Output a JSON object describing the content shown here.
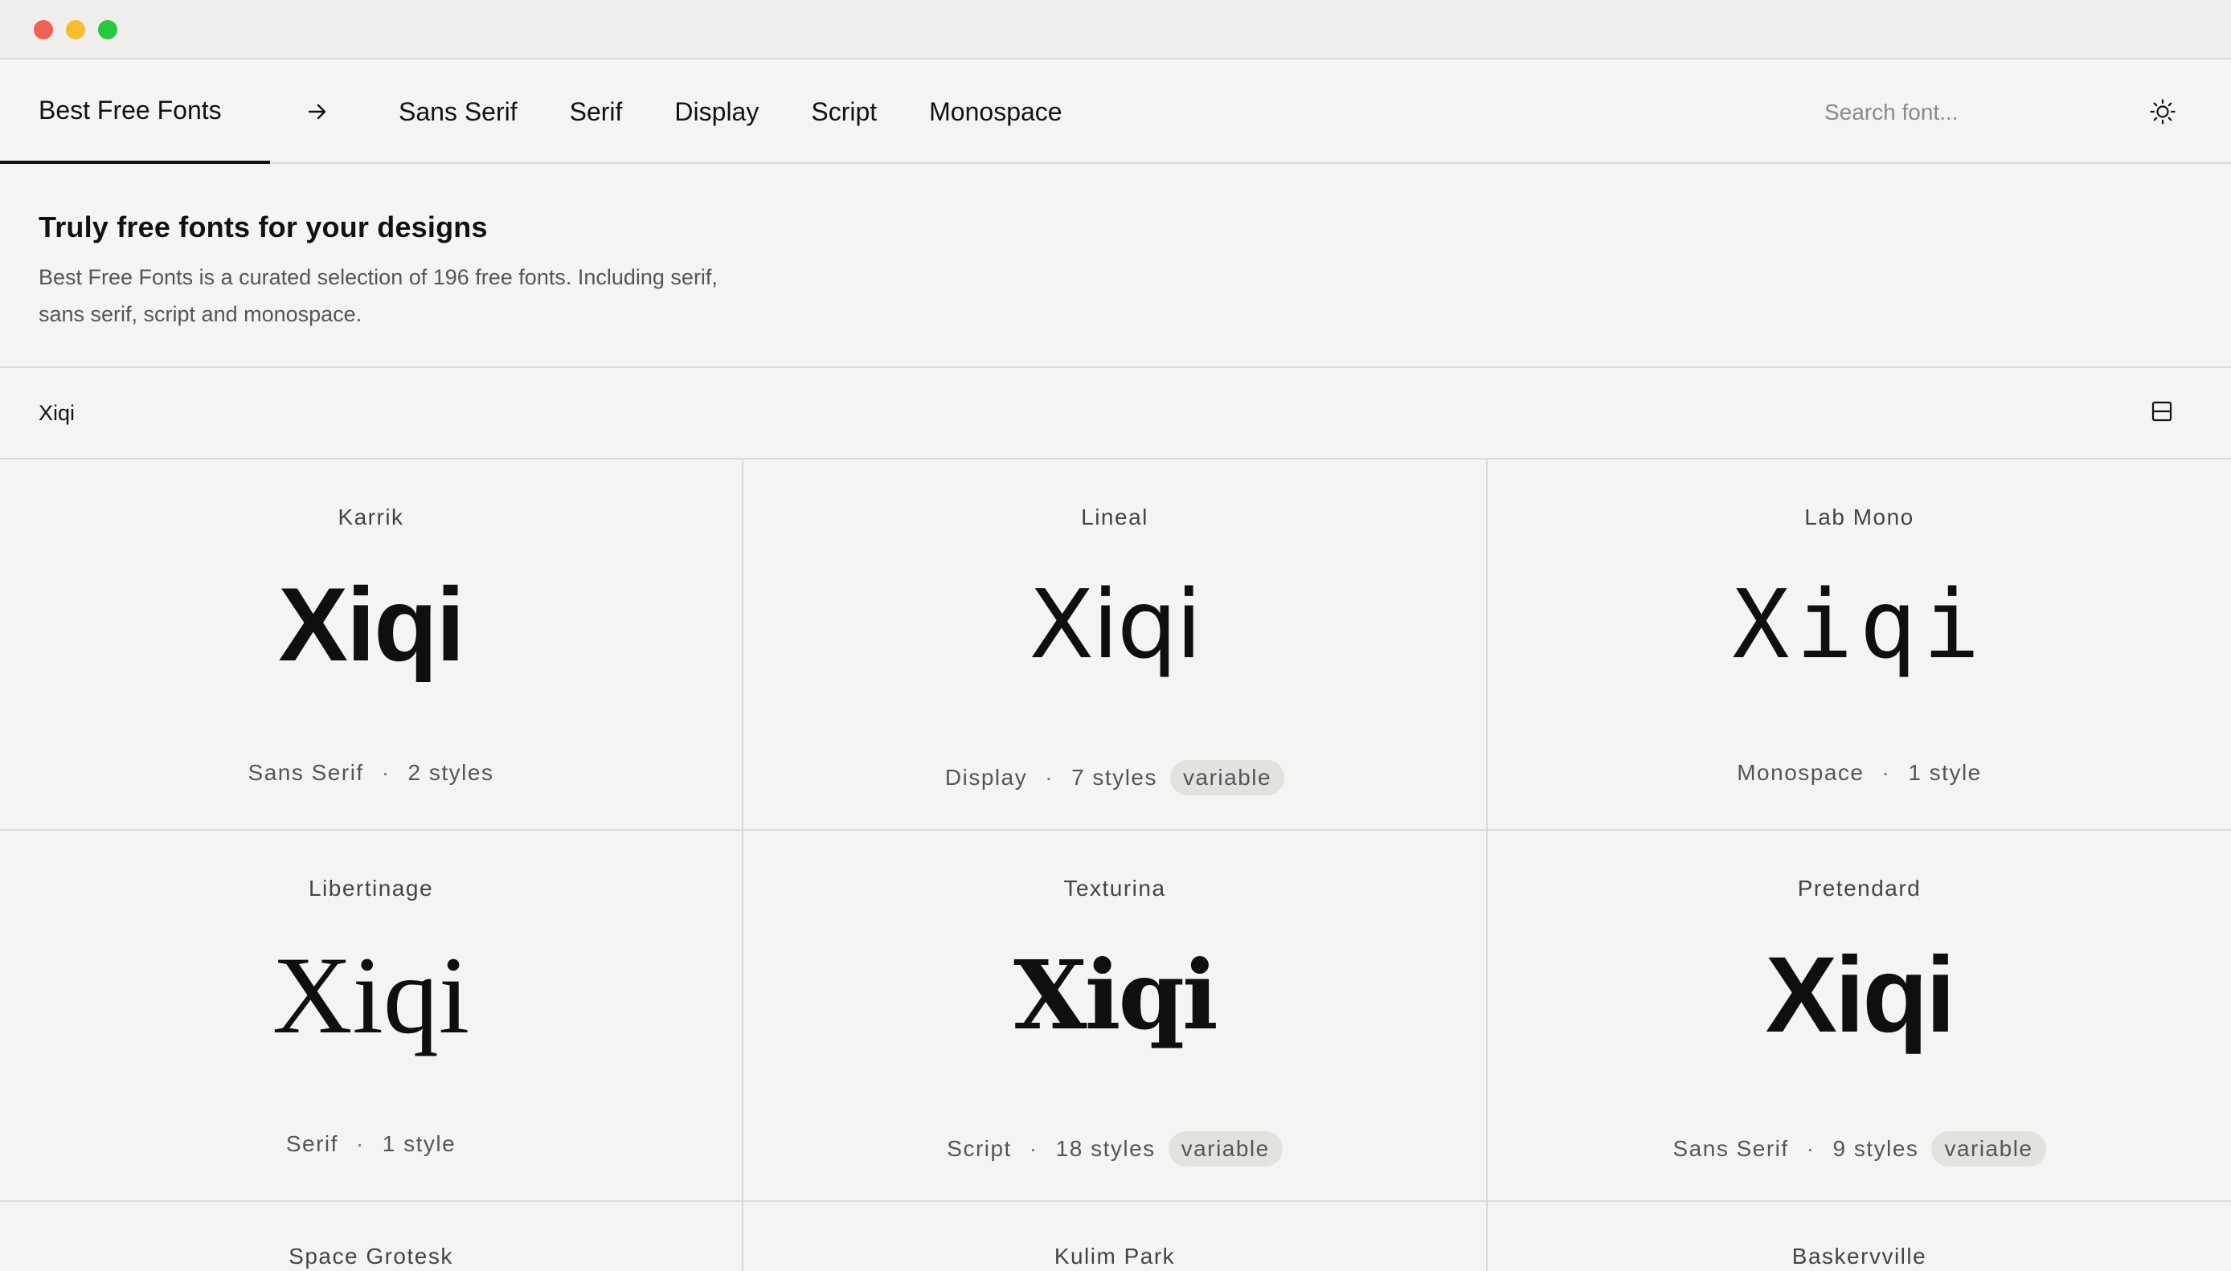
{
  "window": {
    "controls": [
      "close",
      "minimize",
      "maximize"
    ]
  },
  "nav": {
    "brand": "Best Free Fonts",
    "arrow_icon": "arrow-right-icon",
    "links": [
      "Sans Serif",
      "Serif",
      "Display",
      "Script",
      "Monospace"
    ],
    "search_placeholder": "Search font...",
    "theme_icon": "sun-icon"
  },
  "intro": {
    "title": "Truly free fonts for your designs",
    "description": "Best Free Fonts is a curated selection of 196 free fonts. Including serif, sans serif, script and monospace."
  },
  "preview": {
    "text": "Xiqi",
    "layout_icon": "layout-toggle-icon"
  },
  "fonts": [
    {
      "name": "Karrik",
      "sample": "Xiqi",
      "category": "Sans Serif",
      "sep": "·",
      "styles": "2 styles",
      "badge": ""
    },
    {
      "name": "Lineal",
      "sample": "Xiqi",
      "category": "Display",
      "sep": "·",
      "styles": "7 styles",
      "badge": "variable"
    },
    {
      "name": "Lab Mono",
      "sample": "Xiqi",
      "category": "Monospace",
      "sep": "·",
      "styles": "1 style",
      "badge": ""
    },
    {
      "name": "Libertinage",
      "sample": "Xiqi",
      "category": "Serif",
      "sep": "·",
      "styles": "1 style",
      "badge": ""
    },
    {
      "name": "Texturina",
      "sample": "Xiqi",
      "category": "Script",
      "sep": "·",
      "styles": "18 styles",
      "badge": "variable"
    },
    {
      "name": "Pretendard",
      "sample": "Xiqi",
      "category": "Sans Serif",
      "sep": "·",
      "styles": "9 styles",
      "badge": "variable"
    },
    {
      "name": "Space Grotesk"
    },
    {
      "name": "Kulim Park"
    },
    {
      "name": "Baskervville"
    }
  ],
  "colors": {
    "background": "#f5f4f2",
    "border": "#dcdad7",
    "text": "#111111",
    "badge_bg": "#e3e2df"
  }
}
